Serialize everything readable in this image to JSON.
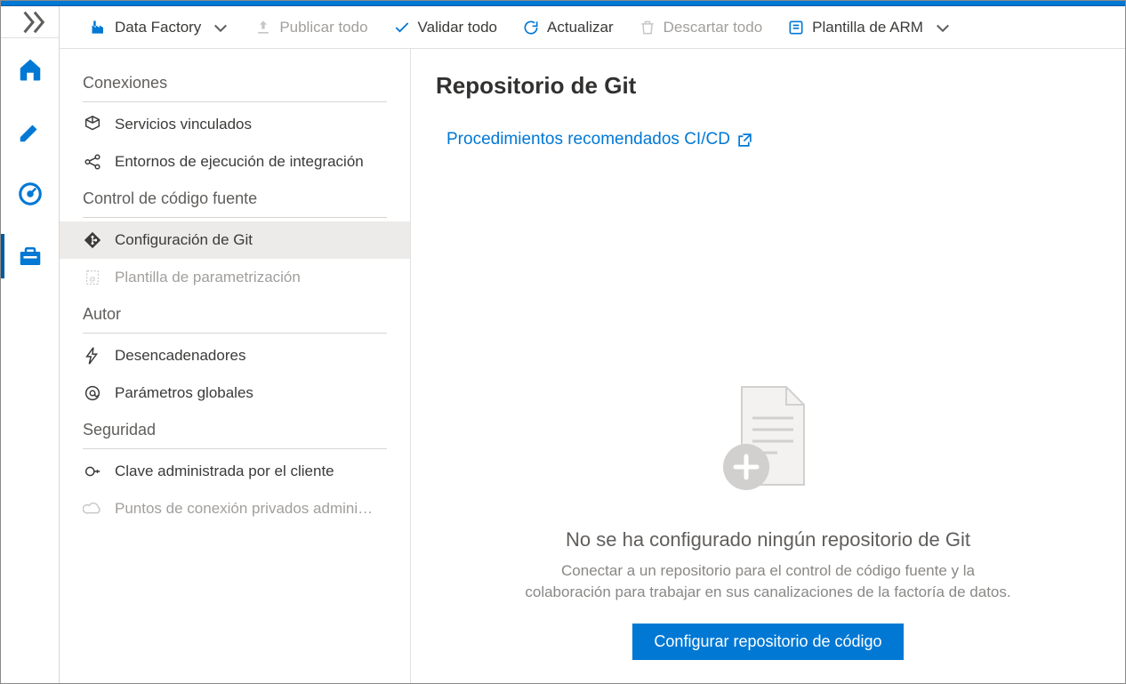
{
  "toolbar": {
    "app_label": "Data Factory",
    "publish_all": "Publicar todo",
    "validate_all": "Validar todo",
    "refresh": "Actualizar",
    "discard_all": "Descartar todo",
    "arm_template": "Plantilla de ARM"
  },
  "panel": {
    "groups": {
      "connections": {
        "title": "Conexiones",
        "linked_services": "Servicios vinculados",
        "integration_runtimes": "Entornos de ejecución de integración"
      },
      "source_control": {
        "title": "Control de código fuente",
        "git_config": "Configuración de Git",
        "param_template": "Plantilla de parametrización"
      },
      "author": {
        "title": "Autor",
        "triggers": "Desencadenadores",
        "global_params": "Parámetros globales"
      },
      "security": {
        "title": "Seguridad",
        "cmk": "Clave administrada por el cliente",
        "private_endpoints": "Puntos de conexión privados admini…"
      }
    }
  },
  "detail": {
    "title": "Repositorio de Git",
    "link_label": "Procedimientos recomendados CI/CD",
    "empty_title": "No se ha configurado ningún repositorio de Git",
    "empty_text": "Conectar a un repositorio para el control de código fuente y la colaboración para trabajar en sus canalizaciones de la factoría de datos.",
    "primary_button": "Configurar repositorio de código"
  }
}
